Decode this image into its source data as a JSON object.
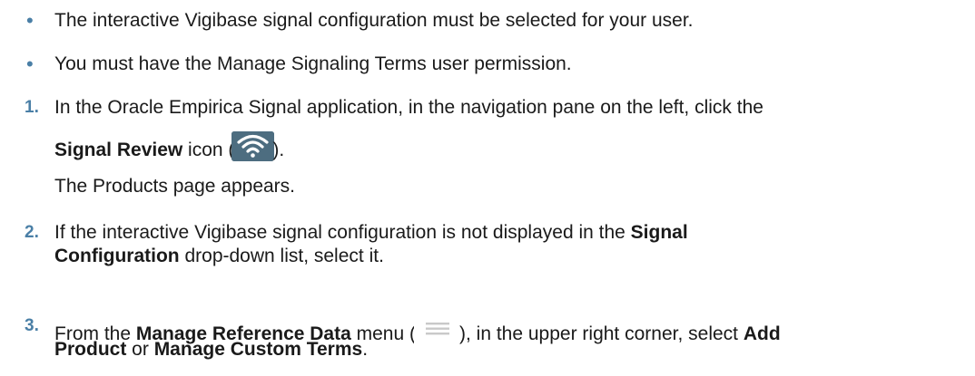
{
  "bullets": [
    "The interactive Vigibase signal configuration must be selected for your user.",
    "You must have the Manage Signaling Terms user permission."
  ],
  "bullet_marker": "•",
  "accent_color": "#4a7fa6",
  "steps": {
    "s1": {
      "number": "1.",
      "line1": "In the Oracle Empirica Signal application, in the navigation pane on the left, click the",
      "bold": "Signal Review",
      "after_bold": " icon (",
      "close": ").",
      "icon": "signal-review-wifi-icon",
      "result": "The Products page appears."
    },
    "s2": {
      "number": "2.",
      "line1_pre": "If the interactive Vigibase signal configuration is not displayed in the ",
      "line1_bold": "Signal",
      "line2_bold": "Configuration",
      "line2_post": " drop-down list, select it."
    },
    "s3": {
      "number": "3.",
      "pre": "From the ",
      "bold1": "Manage Reference Data",
      "mid1": " menu (",
      "icon": "hamburger-menu-icon",
      "mid2": "), in the upper right corner, select ",
      "bold2": "Add",
      "line2_bold1": "Product",
      "line2_mid": " or ",
      "line2_bold2": "Manage Custom Terms",
      "line2_post": "."
    }
  }
}
